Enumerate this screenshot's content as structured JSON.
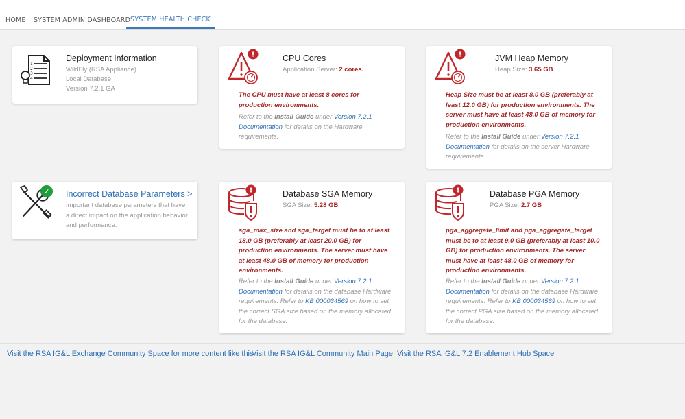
{
  "nav": {
    "tabs": [
      {
        "label": "HOME"
      },
      {
        "label": "SYSTEM ADMIN DASHBOARD"
      },
      {
        "label": "SYSTEM HEALTH CHECK"
      }
    ]
  },
  "colors": {
    "accent": "#3b78b5",
    "error": "#c0272d",
    "ok": "#1f9d3a",
    "link": "#2d6fb6"
  },
  "cards": {
    "deployment": {
      "title": "Deployment Information",
      "line1": "WildFly (RSA Appliance)",
      "line2": "Local Database",
      "line3": "Version 7.2.1 GA"
    },
    "cpu": {
      "title": "CPU Cores",
      "sub_label": "Application Server:",
      "sub_value": "2 cores.",
      "warning": "The CPU must have at least 8 cores for production environments.",
      "note_prefix": "Refer to the",
      "note_guide": "Install Guide",
      "note_under": "under",
      "note_link": "Version 7.2.1 Documentation",
      "note_suffix": "for details on the Hardware requirements."
    },
    "jvm": {
      "title": "JVM Heap Memory",
      "sub_label": "Heap Size:",
      "sub_value": "3.65 GB",
      "warning": "Heap Size must be at least 8.0 GB (preferably at least 12.0 GB) for production environments. The server must have at least 48.0 GB of memory for production environments.",
      "note_prefix": "Refer to the",
      "note_guide": "Install Guide",
      "note_under": "under",
      "note_link": "Version 7.2.1 Documentation",
      "note_suffix": "for details on the server Hardware requirements."
    },
    "dbparams": {
      "title": "Incorrect Database Parameters >",
      "desc": "Important database parameters that have a direct impact on the application behavior and performance."
    },
    "sga": {
      "title": "Database SGA Memory",
      "sub_label": "SGA Size:",
      "sub_value": "5.28 GB",
      "warning": "sga_max_size and sga_target must be to at least 18.0 GB (preferably at least 20.0 GB) for production environments. The server must have at least 48.0 GB of memory for production environments.",
      "note_prefix": "Refer to the",
      "note_guide": "Install Guide",
      "note_under": "under",
      "note_link": "Version 7.2.1 Documentation",
      "note_mid": "for details on the database Hardware requirements. Refer to",
      "note_kb": "KB 000034569",
      "note_suffix": "on how to set the correct SGA size based on the memory allocated for the database."
    },
    "pga": {
      "title": "Database PGA Memory",
      "sub_label": "PGA Size:",
      "sub_value": "2.7 GB",
      "warning": "pga_aggregate_limit and pga_aggregate_target must be to at least 9.0 GB (preferably at least 10.0 GB) for production environments. The server must have at least 48.0 GB of memory for production environments.",
      "note_prefix": "Refer to the",
      "note_guide": "Install Guide",
      "note_under": "under",
      "note_link": "Version 7.2.1 Documentation",
      "note_mid": "for details on the database Hardware requirements. Refer to",
      "note_kb": "KB 000034569",
      "note_suffix": "on how to set the correct PGA size based on the memory allocated for the database."
    }
  },
  "icons": {
    "deployment": "document-lightbulb-icon",
    "cpu": "warning-gauge-icon",
    "jvm": "warning-gauge-icon",
    "dbparams": "tools-icon",
    "sga": "database-warning-icon",
    "pga": "database-warning-icon",
    "alert_badge": "!",
    "ok_badge": "✓"
  },
  "footer": {
    "links": [
      {
        "label": "Visit the RSA IG&L Exchange Community Space for more content like this"
      },
      {
        "label": "Visit the RSA IG&L Community Main Page"
      },
      {
        "label": "Visit the RSA IG&L 7.2 Enablement Hub Space"
      }
    ]
  }
}
